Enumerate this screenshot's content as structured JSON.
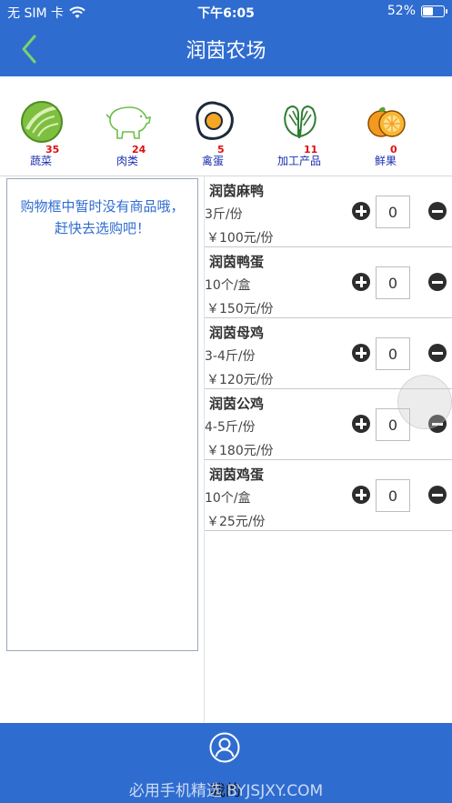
{
  "status_bar": {
    "carrier": "无 SIM 卡",
    "time": "下午6:05",
    "battery_percent": "52%",
    "battery_level": 0.52
  },
  "nav": {
    "title": "润茵农场",
    "back_icon": "chevron-left-icon"
  },
  "categories": [
    {
      "label": "蔬菜",
      "count": "35",
      "icon": "cabbage-icon"
    },
    {
      "label": "肉类",
      "count": "24",
      "icon": "pig-icon"
    },
    {
      "label": "禽蛋",
      "count": "5",
      "icon": "fried-egg-icon"
    },
    {
      "label": "加工产品",
      "count": "11",
      "icon": "spinach-icon"
    },
    {
      "label": "鲜果",
      "count": "0",
      "icon": "orange-icon"
    }
  ],
  "cart": {
    "empty_message": "购物框中暂时没有商品哦，赶快去选购吧！"
  },
  "products": [
    {
      "name": "润茵麻鸭",
      "spec": "3斤/份",
      "price": "￥100元/份",
      "qty": "0"
    },
    {
      "name": "润茵鸭蛋",
      "spec": "10个/盒",
      "price": "￥150元/份",
      "qty": "0"
    },
    {
      "name": "润茵母鸡",
      "spec": "3-4斤/份",
      "price": "￥120元/份",
      "qty": "0"
    },
    {
      "name": "润茵公鸡",
      "spec": "4-5斤/份",
      "price": "￥180元/份",
      "qty": "0"
    },
    {
      "name": "润茵鸡蛋",
      "spec": "10个/盒",
      "price": "￥25元/份",
      "qty": "0"
    }
  ],
  "tab_bar": {
    "profile_label": "我的",
    "profile_icon": "user-circle-icon"
  },
  "watermark": "必用手机精选 BYJSJXY.COM",
  "colors": {
    "primary": "#2f6cd0",
    "count_red": "#e01010",
    "category_label": "#1a2fb0"
  }
}
